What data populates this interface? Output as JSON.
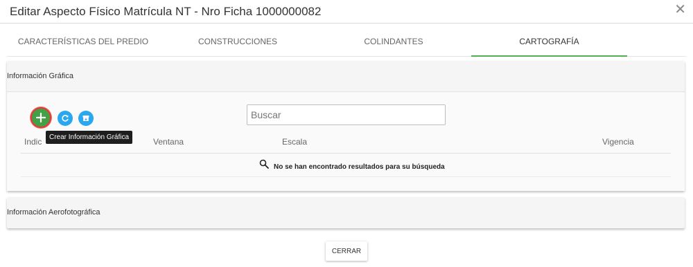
{
  "modal": {
    "title": "Editar Aspecto Físico Matrícula NT - Nro Ficha 1000000082",
    "close_icon": "close-icon"
  },
  "tabs": [
    {
      "label": "CARACTERÍSTICAS DEL PREDIO",
      "active": false
    },
    {
      "label": "CONSTRUCCIONES",
      "active": false
    },
    {
      "label": "COLINDANTES",
      "active": false
    },
    {
      "label": "CARTOGRAFÍA",
      "active": true
    }
  ],
  "colors": {
    "active_tab_underline": "#4caf50",
    "add_button": "#43a047",
    "add_button_ring": "#e53935",
    "action_blue": "#29a8f0"
  },
  "grafica": {
    "heading": "Información Gráfica",
    "add_tooltip": "Crear Información Gráfica",
    "search_placeholder": "Buscar",
    "columns": [
      "Indic",
      "Ventana",
      "Escala",
      "Vigencia"
    ],
    "empty_message": "No se han encontrado resultados para su búsqueda"
  },
  "aerofotografica": {
    "heading": "Información Aerofotográfica"
  },
  "footer": {
    "close_label": "CERRAR"
  }
}
